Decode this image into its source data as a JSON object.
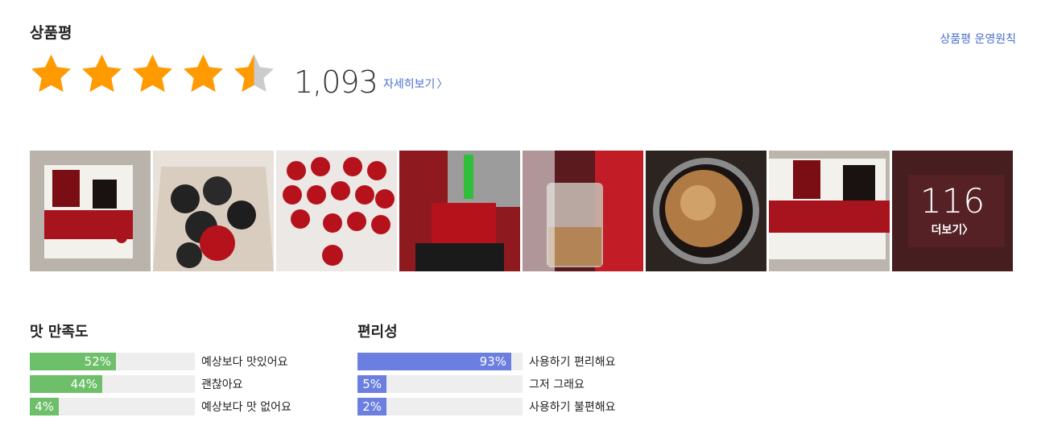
{
  "header": {
    "title": "상품평",
    "policy_link": "상품평 운영원칙"
  },
  "rating": {
    "score": 4.5,
    "max": 5,
    "count": "1,093",
    "detail_link": "자세히보기",
    "detail_chevron": "〉",
    "star_color": "#ff9a00",
    "empty_color": "#cccccc"
  },
  "gallery": {
    "more_count": "116",
    "more_label": "더보기〉"
  },
  "taste": {
    "title": "맛 만족도",
    "color": "#6dbf6a",
    "rows": [
      {
        "pct": "52%",
        "value": 0.52,
        "label": "예상보다 맛있어요"
      },
      {
        "pct": "44%",
        "value": 0.44,
        "label": "괜찮아요"
      },
      {
        "pct": "4%",
        "value": 0.04,
        "label": "예상보다 맛 없어요"
      }
    ]
  },
  "convenience": {
    "title": "편리성",
    "color": "#6b7fe0",
    "rows": [
      {
        "pct": "93%",
        "value": 0.93,
        "label": "사용하기 편리해요"
      },
      {
        "pct": "5%",
        "value": 0.05,
        "label": "그저 그래요"
      },
      {
        "pct": "2%",
        "value": 0.02,
        "label": "사용하기 불편해요"
      }
    ]
  }
}
